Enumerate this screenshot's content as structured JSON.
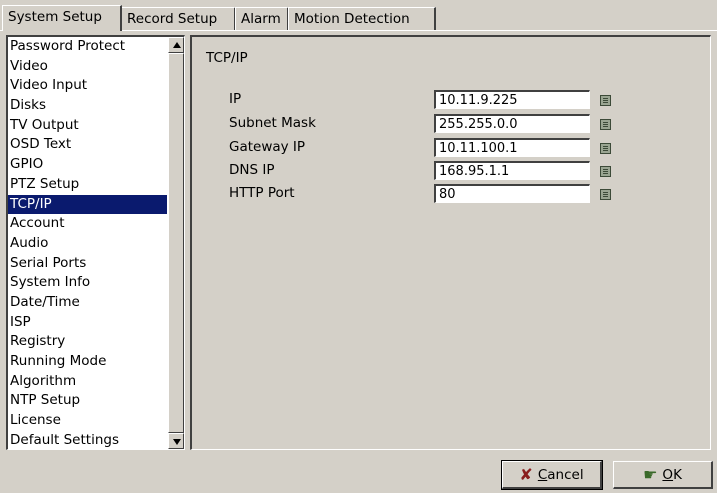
{
  "tabs": [
    {
      "label": "System Setup",
      "active": true
    },
    {
      "label": "Record Setup",
      "active": false
    },
    {
      "label": "Alarm",
      "active": false
    },
    {
      "label": "Motion Detection",
      "active": false
    }
  ],
  "sidebar": {
    "items": [
      {
        "label": "Password Protect"
      },
      {
        "label": "Video"
      },
      {
        "label": "Video Input"
      },
      {
        "label": "Disks"
      },
      {
        "label": "TV Output"
      },
      {
        "label": "OSD Text"
      },
      {
        "label": "GPIO"
      },
      {
        "label": "PTZ Setup"
      },
      {
        "label": "TCP/IP",
        "selected": true
      },
      {
        "label": "Account"
      },
      {
        "label": "Audio"
      },
      {
        "label": "Serial Ports"
      },
      {
        "label": "System Info"
      },
      {
        "label": "Date/Time"
      },
      {
        "label": "ISP"
      },
      {
        "label": "Registry"
      },
      {
        "label": "Running Mode"
      },
      {
        "label": "Algorithm"
      },
      {
        "label": "NTP Setup"
      },
      {
        "label": "License"
      },
      {
        "label": "Default Settings"
      }
    ]
  },
  "main": {
    "title": "TCP/IP",
    "fields": [
      {
        "label": "IP",
        "value": "10.11.9.225"
      },
      {
        "label": "Subnet Mask",
        "value": "255.255.0.0"
      },
      {
        "label": "Gateway IP",
        "value": "10.11.100.1"
      },
      {
        "label": "DNS IP",
        "value": "168.95.1.1"
      },
      {
        "label": "HTTP Port",
        "value": "80"
      }
    ]
  },
  "footer": {
    "cancel_prefix": "",
    "cancel_u": "C",
    "cancel_rest": "ancel",
    "ok_u": "O",
    "ok_rest": "K"
  },
  "colors": {
    "background": "#d4d0c8",
    "selection": "#0a1a6e"
  },
  "icons": {
    "keyboard": "keyboard-icon",
    "cancel": "x-icon",
    "ok": "ok-hand-icon"
  }
}
